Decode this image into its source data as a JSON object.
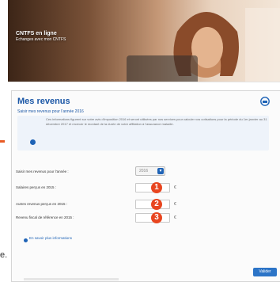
{
  "banner": {
    "title": "CNTFS en ligne",
    "subtitle": "Echanges avec mon CNTFS"
  },
  "form": {
    "title": "Mes revenus",
    "subtitle": "Saisir mes revenus pour l'année 2016",
    "info_text": "Ces informations figurent sur votre avis d'imposition 2016 et seront utilisées par nos services pour calculer vos cotisations pour la période du 1er janvier au 31 décembre 2017 et recevoir le montant de la durée de votre affiliation à l'assurance maladie.",
    "year_label": "Saisir mes revenus pour l'année :",
    "year_value": "2016",
    "fields": [
      {
        "label": "Salaires perçus en 2015 :",
        "badge": "1",
        "currency": "€"
      },
      {
        "label": "Autres revenus perçus en 2015 :",
        "badge": "2",
        "currency": "€"
      },
      {
        "label": "Revenu fiscal de référence en 2015 :",
        "badge": "3",
        "currency": "€"
      }
    ],
    "more_link": "En savoir plus informations",
    "validate_label": "Valider"
  },
  "edge_text": "e.",
  "colors": {
    "title_blue": "#1b57a6",
    "badge_red": "#e8451f",
    "button_blue": "#2c74c7"
  }
}
